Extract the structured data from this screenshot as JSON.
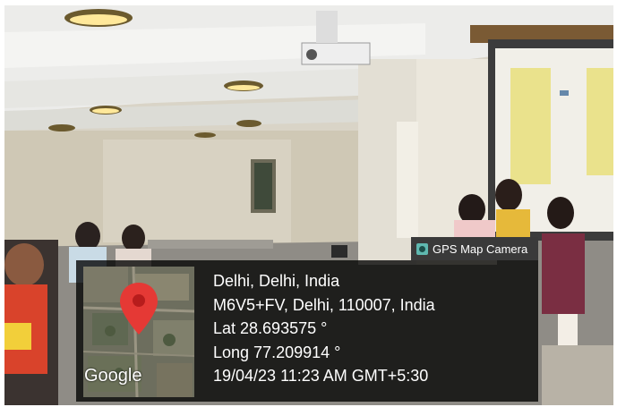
{
  "badge": {
    "label": "GPS Map Camera",
    "icon": "gps-map-camera-icon"
  },
  "map": {
    "watermark": "Google",
    "pin_color": "#e53935"
  },
  "location": {
    "place": "Delhi, Delhi, India",
    "address": "M6V5+FV, Delhi, 110007, India",
    "latitude": "Lat 28.693575 °",
    "longitude": "Long 77.209914 °",
    "datetime": "19/04/23 11:23 AM GMT+5:30"
  }
}
